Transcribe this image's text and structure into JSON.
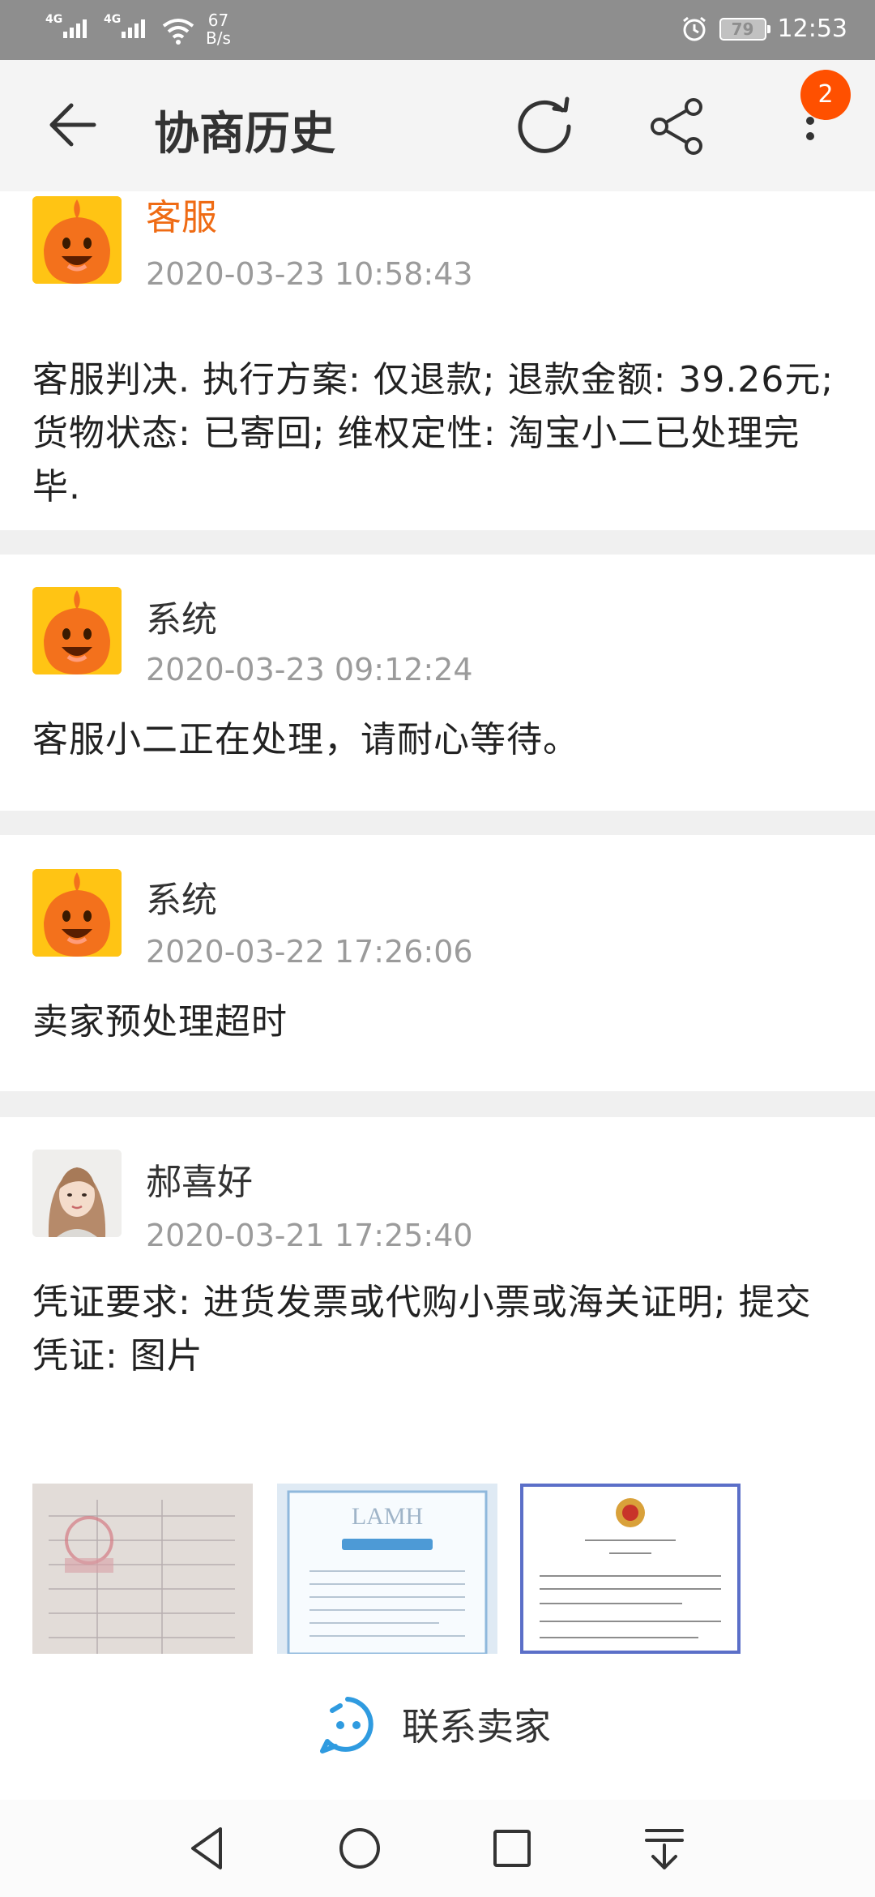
{
  "status_bar": {
    "network_1": "4G",
    "network_2": "4G",
    "speed_value": "67",
    "speed_unit": "B/s",
    "battery": "79",
    "time": "12:53"
  },
  "app_bar": {
    "title": "协商历史",
    "more_badge": "2",
    "icons": [
      "back-arrow-icon",
      "refresh-icon",
      "share-icon",
      "more-vertical-icon"
    ]
  },
  "history": [
    {
      "sender": "客服",
      "time": "2020-03-23 10:58:43",
      "message": "客服判决. 执行方案: 仅退款; 退款金额: 39.26元; 货物状态: 已寄回; 维权定性: 淘宝小二已处理完毕."
    },
    {
      "sender": "系统",
      "time": "2020-03-23 09:12:24",
      "message": "客服小二正在处理，请耐心等待。"
    },
    {
      "sender": "系统",
      "time": "2020-03-22 17:26:06",
      "message": "卖家预处理超时"
    },
    {
      "sender": "郝喜好",
      "time": "2020-03-21 17:25:40",
      "message": "凭证要求: 进货发票或代购小票或海关证明; 提交凭证: 图片"
    }
  ],
  "evidence_images": [
    "receipt-image",
    "brand-document-image",
    "certificate-image"
  ],
  "contact": {
    "label": "联系卖家"
  },
  "colors": {
    "accent": "#ff5000",
    "sender_highlight": "#ef6b14",
    "avatar_yellow": "#ffc414",
    "status_bar": "#8e8e8e"
  }
}
